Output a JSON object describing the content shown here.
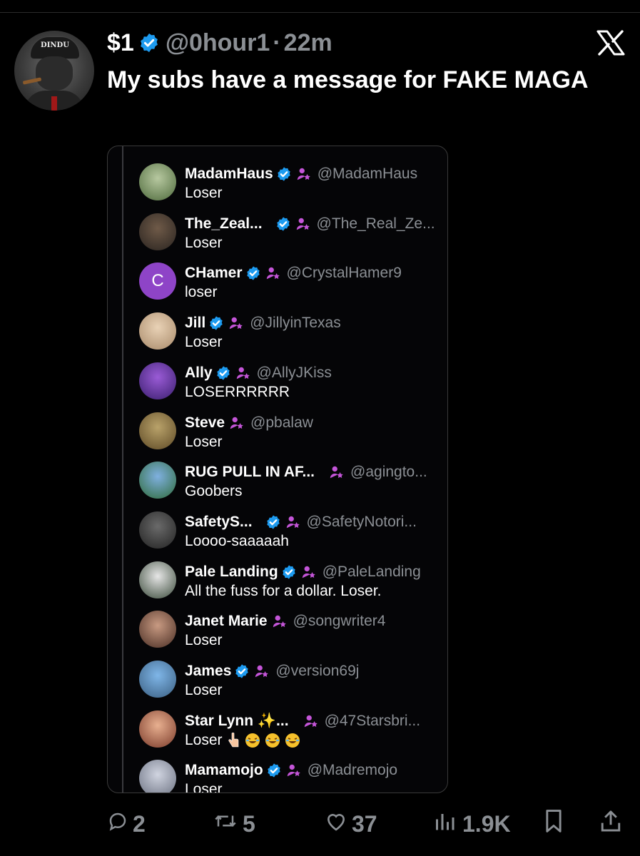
{
  "tweet": {
    "display_name": "$1",
    "handle": "@0hour1",
    "separator": "·",
    "time": "22m",
    "text": "My subs have a message for FAKE MAGA",
    "avatar_cap_text": "DINDU"
  },
  "colors": {
    "verified": "#1d9bf0",
    "subscriber": "#c455d8",
    "muted": "#8b8f94"
  },
  "card": {
    "replies": [
      {
        "name": "MadamHaus",
        "handle": "@MadamHaus",
        "text": "Loser",
        "verified": true
      },
      {
        "name": "The_Zeal...",
        "handle": "@The_Real_Ze...",
        "text": "Loser",
        "verified": true
      },
      {
        "name": "CHamer",
        "handle": "@CrystalHamer9",
        "text": "loser",
        "verified": true,
        "avatar_letter": "C"
      },
      {
        "name": "Jill",
        "handle": "@JillyinTexas",
        "text": "Loser",
        "verified": true
      },
      {
        "name": "Ally",
        "handle": "@AllyJKiss",
        "text": "LOSERRRRRR",
        "verified": true
      },
      {
        "name": "Steve",
        "handle": "@pbalaw",
        "text": "Loser",
        "verified": false
      },
      {
        "name": "RUG PULL IN AF...",
        "handle": "@agingto...",
        "text": "Goobers",
        "verified": false
      },
      {
        "name": "SafetyS...",
        "handle": "@SafetyNotori...",
        "text": "Loooo-saaaaah",
        "verified": true
      },
      {
        "name": "Pale Landing",
        "handle": "@PaleLanding",
        "text": "All the fuss for a dollar. Loser.",
        "verified": true
      },
      {
        "name": "Janet Marie",
        "handle": "@songwriter4",
        "text": "Loser",
        "verified": false
      },
      {
        "name": "James",
        "handle": "@version69j",
        "text": "Loser",
        "verified": true
      },
      {
        "name": "Star Lynn ✨...",
        "handle": "@47Starsbri...",
        "text": "Loser",
        "verified": false,
        "emoji": [
          "pointing-hand",
          "rofl",
          "rofl",
          "rofl"
        ]
      },
      {
        "name": "Mamamojo",
        "handle": "@Madremojo",
        "text": "Loser",
        "verified": true
      }
    ]
  },
  "actions": {
    "replies": "2",
    "reposts": "5",
    "likes": "37",
    "views": "1.9K"
  },
  "icons": [
    "verified-badge-icon",
    "subscriber-badge-icon",
    "x-logo-icon",
    "reply-icon",
    "repost-icon",
    "like-icon",
    "views-icon",
    "bookmark-icon",
    "share-icon"
  ]
}
